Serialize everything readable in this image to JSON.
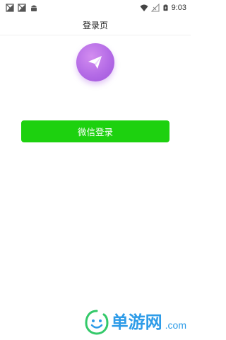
{
  "status_bar": {
    "time": "9:03",
    "left_icons": [
      "sim-blocked-icon",
      "sim-blocked-icon",
      "android-notification-icon"
    ],
    "right_icons": [
      "wifi-icon",
      "no-signal-icon",
      "battery-charging-icon"
    ]
  },
  "header": {
    "title": "登录页"
  },
  "logo": {
    "icon": "paper-plane-icon",
    "color_primary": "#b46be6"
  },
  "login": {
    "wechat_button_label": "微信登录",
    "button_color": "#1dd10f"
  },
  "watermark": {
    "brand": "单游网",
    "suffix": ".com",
    "color": "#2e9ce8"
  }
}
